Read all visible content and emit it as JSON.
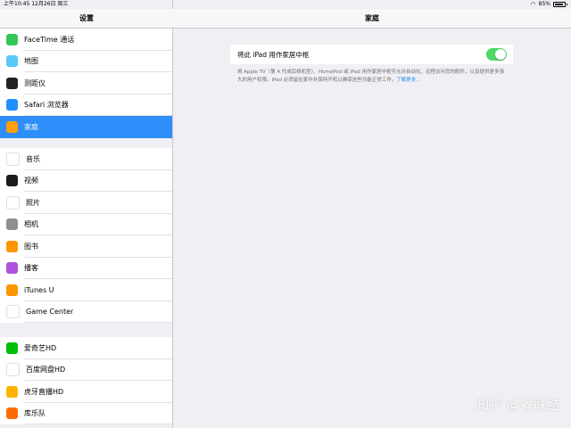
{
  "status": {
    "time": "上午10:45",
    "date": "12月26日 周三",
    "battery": "85%",
    "battery_level": 0.85
  },
  "sidebar": {
    "title": "设置",
    "group1": [
      {
        "label": "FaceTime 通话",
        "icon": "facetime-icon",
        "color": "#34c759"
      },
      {
        "label": "地图",
        "icon": "maps-icon",
        "color": "#5ac8fa"
      },
      {
        "label": "测距仪",
        "icon": "measure-icon",
        "color": "#222222"
      },
      {
        "label": "Safari 浏览器",
        "icon": "safari-icon",
        "color": "#1e90ff"
      },
      {
        "label": "家庭",
        "icon": "home-icon",
        "color": "#ff9f0a",
        "selected": true
      }
    ],
    "group2": [
      {
        "label": "音乐",
        "icon": "music-icon",
        "color": "#ffffff"
      },
      {
        "label": "视频",
        "icon": "video-icon",
        "color": "#1c1c1e"
      },
      {
        "label": "照片",
        "icon": "photos-icon",
        "color": "#ffffff"
      },
      {
        "label": "相机",
        "icon": "camera-icon",
        "color": "#8e8e93"
      },
      {
        "label": "图书",
        "icon": "books-icon",
        "color": "#ff9500"
      },
      {
        "label": "播客",
        "icon": "podcasts-icon",
        "color": "#af52de"
      },
      {
        "label": "iTunes U",
        "icon": "itunes-u-icon",
        "color": "#ff9500"
      },
      {
        "label": "Game Center",
        "icon": "game-center-icon",
        "color": "#ffffff"
      }
    ],
    "group3": [
      {
        "label": "爱奇艺HD",
        "icon": "iqiyi-icon",
        "color": "#00be06"
      },
      {
        "label": "百度网盘HD",
        "icon": "baidu-netdisk-icon",
        "color": "#ffffff"
      },
      {
        "label": "虎牙直播HD",
        "icon": "huya-icon",
        "color": "#ffb300"
      },
      {
        "label": "库乐队",
        "icon": "garageband-icon",
        "color": "#ff6a00"
      }
    ]
  },
  "main": {
    "title": "家庭",
    "hub_label": "将此 iPad 用作家居中枢",
    "hub_enabled": true,
    "description": "将 Apple TV（第 4 代或后续机型）、HomePod 或 iPad 用作家居中枢可允许自动化、远程访问您的配件，以及提供更多强大的用户权限。iPad 必须留在家中并保持开机以确保这些功能正常工作。",
    "learn_more": "了解更多…"
  },
  "watermark": "知乎 @睿联结"
}
